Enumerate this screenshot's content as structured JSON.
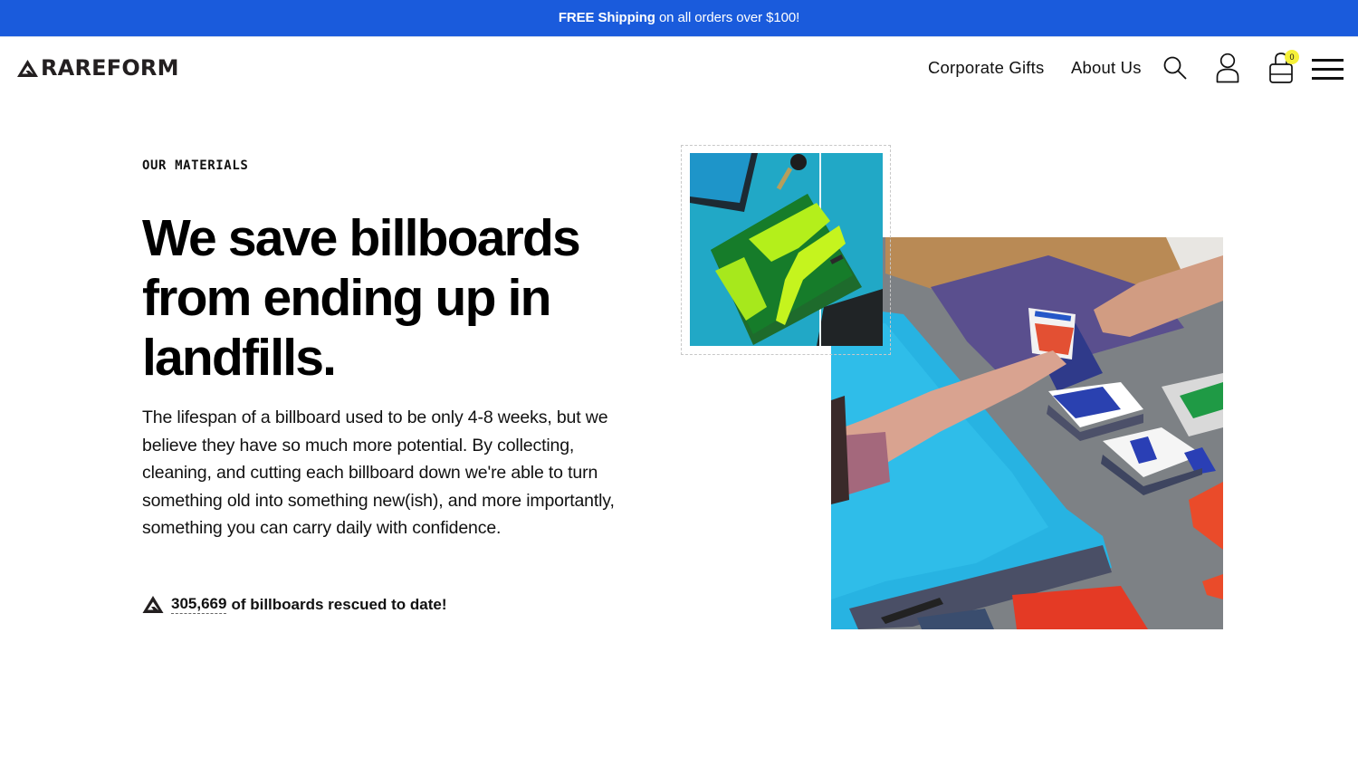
{
  "promo": {
    "bold": "FREE Shipping",
    "rest": " on all orders over $100!",
    "background": "#1a5bdc"
  },
  "header": {
    "logo_text": "RAREFORM",
    "nav": [
      {
        "label": "Corporate Gifts"
      },
      {
        "label": "About Us"
      }
    ],
    "icons": {
      "search": "search-icon",
      "account": "user-icon",
      "cart": "shopping-bag-icon",
      "menu": "hamburger-menu-icon"
    },
    "cart_count": "0",
    "cart_badge_color": "#f5f03a"
  },
  "hero": {
    "eyebrow": "OUR MATERIALS",
    "headline": "We save billboards from ending up in landfills.",
    "body": "The lifespan of a billboard used to be only 4-8 weeks, but we believe they have so much more potential. By collecting, cleaning, and cutting each billboard down we're able to turn something old into something new(ish), and more importantly, something you can carry daily with confidence.",
    "counter_value": "305,669",
    "counter_text": "of billboards rescued to date!",
    "images": [
      {
        "name": "green-billboard-pouch-photo",
        "alt": "Green recycled billboard pouch on teal surface with keys and tablet"
      },
      {
        "name": "billboard-cutting-workshop-photo",
        "alt": "People handing cut billboard pieces across a table with blue tarp"
      }
    ]
  }
}
